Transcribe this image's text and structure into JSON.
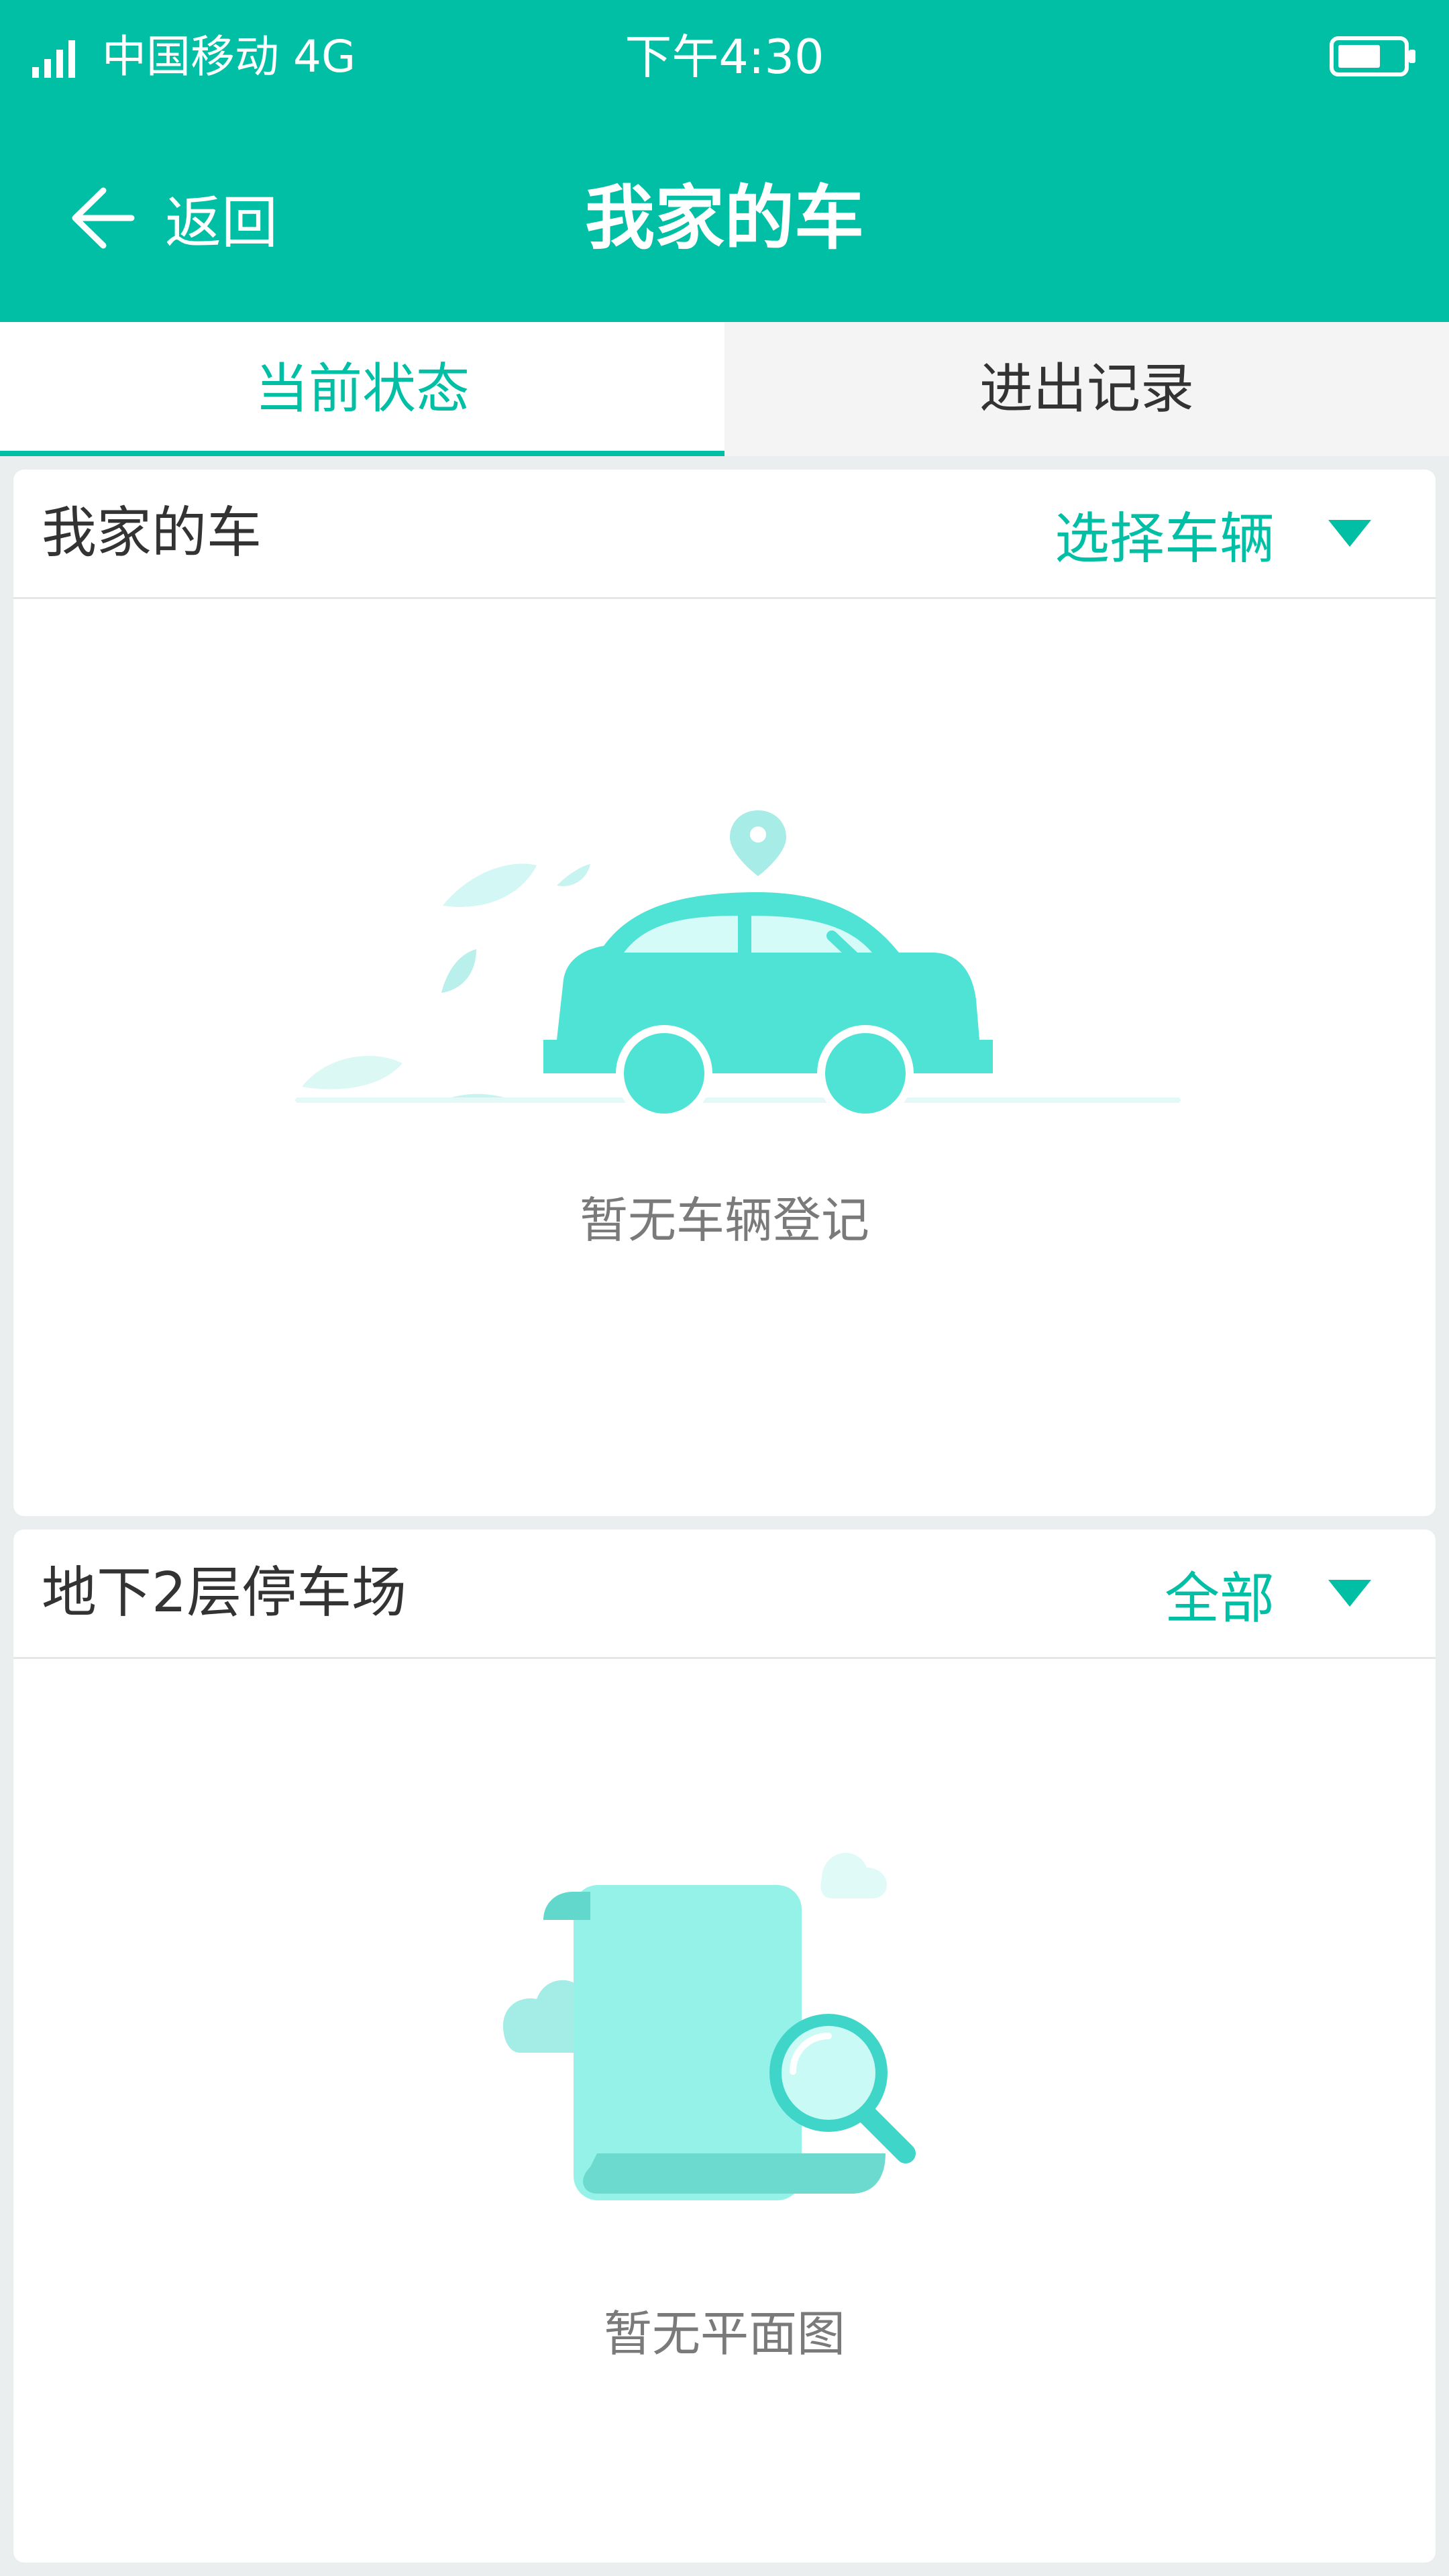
{
  "status_bar": {
    "carrier": "中国移动 4G",
    "time": "下午4:30"
  },
  "nav": {
    "back_label": "返回",
    "title": "我家的车"
  },
  "tabs": [
    {
      "label": "当前状态",
      "active": true
    },
    {
      "label": "进出记录",
      "active": false
    }
  ],
  "car_card": {
    "title": "我家的车",
    "select_label": "选择车辆",
    "empty_text": "暂无车辆登记"
  },
  "floor_card": {
    "title": "地下2层停车场",
    "select_label": "全部",
    "empty_text": "暂无平面图"
  },
  "colors": {
    "accent": "#00bfa5",
    "illustration": "#4fe3d6"
  }
}
